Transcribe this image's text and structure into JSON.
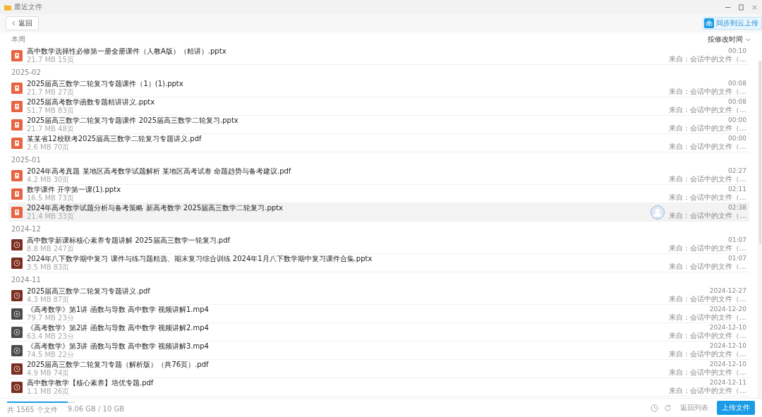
{
  "window": {
    "title": "最近文件"
  },
  "toolbar": {
    "back_label": "返回",
    "sync_badge": "同步到云上传",
    "sort": "按修改时间"
  },
  "groups": [
    {
      "heading": "本周",
      "files": [
        {
          "kind": "ppt",
          "name": "高中数学选择性必修第一册全册课件（人教A版）（精讲）.pptx",
          "meta": "21.7 MB  15页",
          "time": "00:10",
          "source": "来自：会话中的文件（…",
          "selected": false
        }
      ]
    },
    {
      "heading": "2025-02",
      "files": [
        {
          "kind": "ppt",
          "name": "2025届高三数学二轮复习专题课件（1）(1).pptx",
          "meta": "21.7 MB  27页",
          "time": "00:08",
          "source": "来自：会话中的文件（…",
          "selected": false
        },
        {
          "kind": "ppt",
          "name": "2025届高考数学函数专题精讲讲义.pptx",
          "meta": "51.7 MB  83页",
          "time": "00:08",
          "source": "来自：会话中的文件（…",
          "selected": false
        },
        {
          "kind": "ppt",
          "name": "2025届高三数学二轮复习专题课件 2025届高三数学二轮复习.pptx",
          "meta": "21.7 MB  48页",
          "time": "00:00",
          "source": "来自：会话中的文件（…",
          "selected": false
        },
        {
          "kind": "ppt",
          "name": "某某省12校联考2025届高三数学二轮复习专题讲义.pdf",
          "meta": "2.6 MB  70页",
          "time": "00:00",
          "source": "来自：会话中的文件（…",
          "selected": false
        }
      ]
    },
    {
      "heading": "2025-01",
      "files": [
        {
          "kind": "ppt",
          "name": "2024年高考真题 某地区高考数学试题解析      某地区高考试卷 命题趋势与备考建议.pdf",
          "meta": "4.2 MB  30页",
          "time": "02:27",
          "source": "来自：会话中的文件（…",
          "selected": false
        },
        {
          "kind": "ppt",
          "name": "数学课件 开学第一课(1).pptx",
          "meta": "16.5 MB  73页",
          "time": "02:11",
          "source": "来自：会话中的文件（…",
          "selected": false
        },
        {
          "kind": "ppt",
          "name": "2024年高考数学试题分析与备考策略      新高考数学 2025届高三数学二轮复习.pptx",
          "meta": "21.4 MB  33页",
          "time": "02:38",
          "source": "来自：会话中的文件（…",
          "selected": true
        }
      ]
    },
    {
      "heading": "2024-12",
      "files": [
        {
          "kind": "pdf",
          "name": "高中数学新课标核心素养专题讲解 2025届高三数学一轮复习.pdf",
          "meta": "8.8 MB  247页",
          "time": "01:07",
          "source": "来自：会话中的文件（…",
          "selected": false
        },
        {
          "kind": "pdf",
          "name": "2024年八下数学期中复习 课件与练习题精选、期末复习综合训练  2024年1月八下数学期中复习课件合集.pptx",
          "meta": "3.5 MB  83页",
          "time": "01:07",
          "source": "来自：会话中的文件（…",
          "selected": false
        }
      ]
    },
    {
      "heading": "2024-11",
      "files": [
        {
          "kind": "pdf",
          "name": "2025届高三数学二轮复习专题讲义.pdf",
          "meta": "4.3 MB  87页",
          "time": "2024-12-27",
          "source": "来自：会话中的文件（…",
          "selected": false
        },
        {
          "kind": "video",
          "name": "《高考数学》第1讲 函数与导数 高中数学 视频讲解1.mp4",
          "meta": "79.7 MB  23分",
          "time": "2024-12-20",
          "source": "来自：会话中的文件（…",
          "selected": false
        },
        {
          "kind": "video",
          "name": "《高考数学》第2讲 函数与导数 高中数学 视频讲解2.mp4",
          "meta": "63.4 MB  23分",
          "time": "2024-12-10",
          "source": "来自：会话中的文件（…",
          "selected": false
        },
        {
          "kind": "video",
          "name": "《高考数学》第3讲 函数与导数 高中数学 视频讲解3.mp4",
          "meta": "74.5 MB  22分",
          "time": "2024-12-10",
          "source": "来自：会话中的文件（…",
          "selected": false
        },
        {
          "kind": "pdf",
          "name": "2025届高三数学二轮复习专题（解析版）（共76页）.pdf",
          "meta": "4.9 MB  74页",
          "time": "2024-12-10",
          "source": "来自：会话中的文件（…",
          "selected": false
        },
        {
          "kind": "pdf",
          "name": "高中数学教学【核心素养】培优专题.pdf",
          "meta": "1.1 MB  26页",
          "time": "2024-12-11",
          "source": "来自：会话中的文件（…",
          "selected": false
        }
      ]
    }
  ],
  "footer": {
    "file_count": "共 1565 个文件",
    "storage": "9.06 GB / 10 GB",
    "level": 0.9,
    "back_to_list": "返回列表",
    "upload": "上传文件"
  }
}
